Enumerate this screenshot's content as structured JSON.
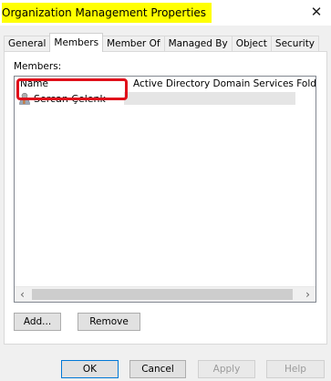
{
  "window": {
    "title": "Organization Management Properties",
    "close_glyph": "✕"
  },
  "tabs": [
    {
      "label": "General",
      "active": false
    },
    {
      "label": "Members",
      "active": true
    },
    {
      "label": "Member Of",
      "active": false
    },
    {
      "label": "Managed By",
      "active": false
    },
    {
      "label": "Object",
      "active": false
    },
    {
      "label": "Security",
      "active": false
    }
  ],
  "members": {
    "label": "Members:",
    "columns": [
      "Name",
      "Active Directory Domain Services Folder"
    ],
    "rows": [
      {
        "name": "Sercan Çelenk",
        "folder": "",
        "icon": "user-icon"
      }
    ],
    "highlight_color": "#e0101b",
    "scroll_left": "‹",
    "scroll_right": "›"
  },
  "actions": {
    "add_label": "Add...",
    "remove_label": "Remove"
  },
  "footer": {
    "ok_label": "OK",
    "cancel_label": "Cancel",
    "apply_label": "Apply",
    "help_label": "Help"
  },
  "colors": {
    "title_highlight": "#ffff00",
    "dialog_bg": "#f0f0f0"
  }
}
